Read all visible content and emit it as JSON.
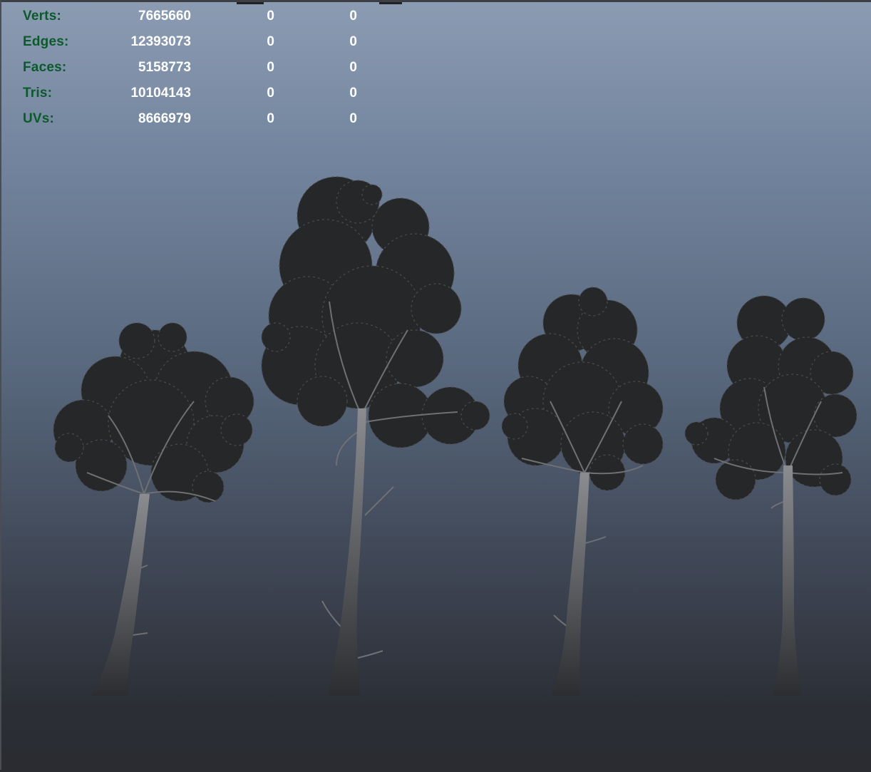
{
  "hud": {
    "rows": [
      {
        "label": "Verts:",
        "total": "7665660",
        "selected": "0",
        "extra": "0"
      },
      {
        "label": "Edges:",
        "total": "12393073",
        "selected": "0",
        "extra": "0"
      },
      {
        "label": "Faces:",
        "total": "5158773",
        "selected": "0",
        "extra": "0"
      },
      {
        "label": "Tris:",
        "total": "10104143",
        "selected": "0",
        "extra": "0"
      },
      {
        "label": "UVs:",
        "total": "8666979",
        "selected": "0",
        "extra": "0"
      }
    ]
  },
  "viewport": {
    "objects": [
      "tree",
      "tree",
      "tree",
      "tree"
    ],
    "colors": {
      "background_top": "#8a9bb2",
      "background_bottom": "#2a2c31",
      "hud_label": "#0c5a2c",
      "hud_value": "#ffffff",
      "foliage": "#262728",
      "trunk": "#5c5e62"
    }
  }
}
